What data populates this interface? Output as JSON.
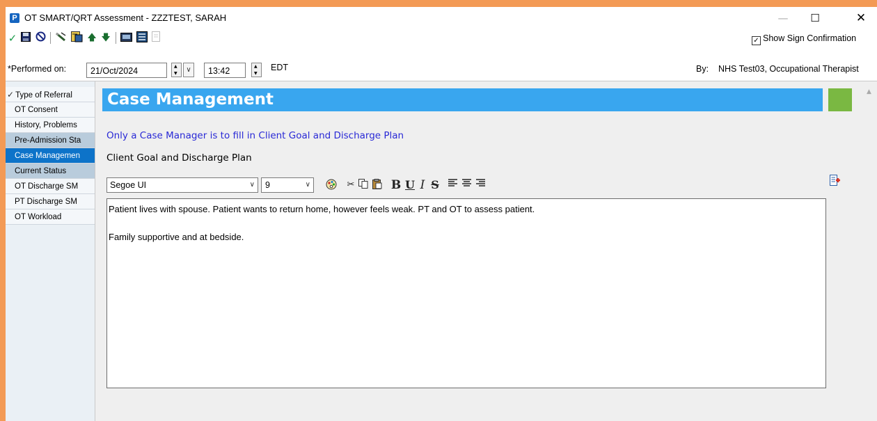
{
  "window": {
    "title": "OT SMART/QRT Assessment - ZZZTEST, SARAH",
    "app_icon": "P",
    "controls": {
      "minimize": "—",
      "maximize": "☐",
      "close": "✕"
    }
  },
  "toolbar": {
    "icons": [
      "sign-check-icon",
      "save-icon",
      "cancel-icon",
      "edit-pencil-icon",
      "form-browser-icon",
      "arrow-up-icon",
      "arrow-down-icon",
      "calculator-icon",
      "reference-icon",
      "print-icon"
    ],
    "show_sign_confirmation": {
      "label": "Show Sign Confirmation",
      "checked": true
    }
  },
  "performed": {
    "label": "*Performed on:",
    "date": "21/Oct/2024",
    "time": "13:42",
    "timezone": "EDT",
    "by_label": "By:",
    "by_value": "NHS Test03, Occupational Therapist"
  },
  "sidebar": {
    "items": [
      {
        "label": "Type of Referral",
        "state": "checked"
      },
      {
        "label": "OT Consent",
        "state": "normal"
      },
      {
        "label": "History, Problems",
        "state": "normal"
      },
      {
        "label": "Pre-Admission Sta",
        "state": "done"
      },
      {
        "label": "Case Managemen",
        "state": "active"
      },
      {
        "label": "Current Status",
        "state": "done"
      },
      {
        "label": "OT Discharge SM",
        "state": "normal"
      },
      {
        "label": "PT Discharge SM",
        "state": "normal"
      },
      {
        "label": "OT Workload",
        "state": "normal"
      }
    ]
  },
  "main": {
    "banner_title": "Case Management",
    "notice": "Only a Case Manager is to fill in Client Goal and Discharge Plan",
    "section_label": "Client Goal and Discharge Plan",
    "rtf": {
      "font": "Segoe UI",
      "size": "9"
    },
    "editor_lines": [
      "Patient lives with spouse. Patient wants to return home, however feels weak. PT and OT to assess patient.",
      "",
      "Family supportive and at bedside."
    ]
  },
  "colors": {
    "frame_border": "#f39a55",
    "banner": "#39a6ef",
    "status_square": "#7ab842",
    "sidebar_active": "#0d73c9",
    "sidebar_done": "#b9ccdc",
    "notice_text": "#2929d6"
  }
}
